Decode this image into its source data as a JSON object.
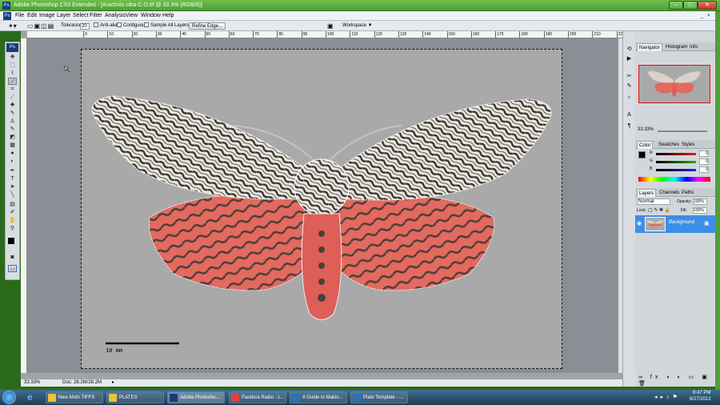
{
  "window": {
    "title": "Adobe Photoshop CS3 Extended - [Arachnis citra-C-D.tif @ 33.3% (RGB/8)]",
    "logo": "Ps"
  },
  "menu": [
    "File",
    "Edit",
    "Image",
    "Layer",
    "Select",
    "Filter",
    "Analysis",
    "View",
    "Window",
    "Help"
  ],
  "options": {
    "tolerance_label": "Tolerance:",
    "tolerance_value": "20",
    "anti_alias": "Anti-alias",
    "contiguous": "Contiguous",
    "sample_all": "Sample All Layers",
    "refine_edge": "Refine Edge...",
    "workspace": "Workspace ▼"
  },
  "ruler": {
    "marks": [
      "0",
      "10",
      "20",
      "30",
      "40",
      "50",
      "60",
      "70",
      "80",
      "90",
      "100",
      "110",
      "120",
      "130",
      "140",
      "150",
      "160",
      "170",
      "180",
      "190",
      "200",
      "210",
      "220"
    ]
  },
  "canvas": {
    "scale_label": "10 mm"
  },
  "status": {
    "zoom": "33.33%",
    "doc": "Doc: 28.2M/28.2M"
  },
  "navigator": {
    "tabs": [
      "Navigator",
      "Histogram",
      "Info"
    ],
    "zoom": "33.33%"
  },
  "color": {
    "tabs": [
      "Color",
      "Swatches",
      "Styles"
    ],
    "channels": [
      {
        "name": "R",
        "value": "0",
        "color": "#d22"
      },
      {
        "name": "G",
        "value": "0",
        "color": "#2a2"
      },
      {
        "name": "B",
        "value": "0",
        "color": "#22d"
      }
    ]
  },
  "layers": {
    "tabs": [
      "Layers",
      "Channels",
      "Paths"
    ],
    "blend": "Normal",
    "opacity_label": "Opacity:",
    "opacity": "100%",
    "lock_label": "Lock:",
    "fill_label": "Fill:",
    "fill": "100%",
    "items": [
      {
        "name": "Background"
      }
    ]
  },
  "taskbar": {
    "items": [
      {
        "label": "New Moth TIFFS",
        "color": "#e8c33a"
      },
      {
        "label": "PLATES",
        "color": "#e8c33a"
      },
      {
        "label": "Adobe Photosho...",
        "color": "#1c3b73"
      },
      {
        "label": "Pandora Radio - L...",
        "color": "#d9453b"
      },
      {
        "label": "A Guide to Makin...",
        "color": "#2f6fbd"
      },
      {
        "label": "Plate Template - ...",
        "color": "#2f6fbd"
      }
    ],
    "time": "8:47 PM",
    "date": "6/27/2012"
  }
}
